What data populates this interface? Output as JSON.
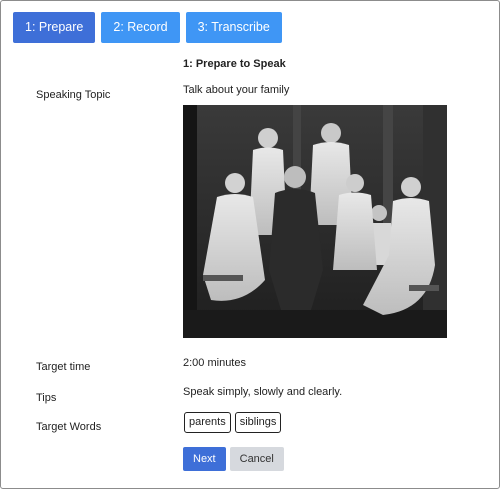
{
  "tabs": [
    {
      "label": "1: Prepare",
      "active": true
    },
    {
      "label": "2: Record",
      "active": false
    },
    {
      "label": "3: Transcribe",
      "active": false
    }
  ],
  "step_title": "1: Prepare to Speak",
  "topic": {
    "label": "Speaking Topic",
    "value": "Talk about your family"
  },
  "photo": {
    "description_icon": "family-portrait-photo"
  },
  "target_time": {
    "label": "Target time",
    "value": "2:00 minutes"
  },
  "tips": {
    "label": "Tips",
    "value": "Speak simply, slowly and clearly."
  },
  "target_words": {
    "label": "Target Words",
    "words": [
      "parents",
      "siblings"
    ]
  },
  "buttons": {
    "next": "Next",
    "cancel": "Cancel"
  },
  "colors": {
    "active_tab": "#3e6fd8",
    "inactive_tab": "#3f96f5",
    "next_button": "#3e6fd8",
    "cancel_button": "#d6d9de"
  }
}
